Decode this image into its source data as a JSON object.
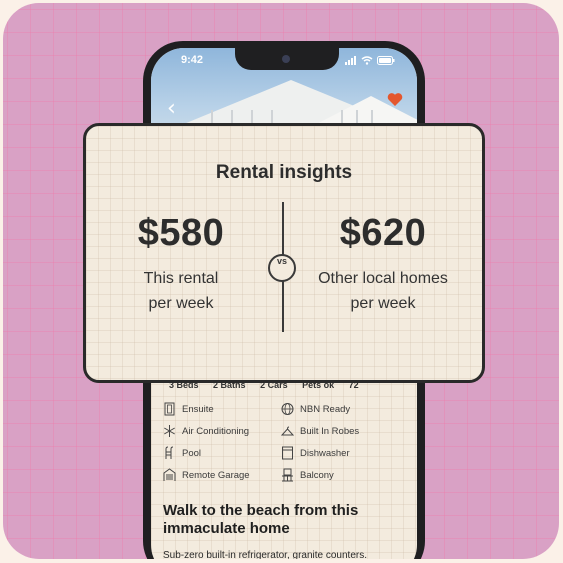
{
  "status_bar": {
    "time": "9:42"
  },
  "listing": {
    "meta": [
      "3 Beds",
      "2 Baths",
      "2 Cars",
      "Pets ok",
      "72"
    ],
    "amenities": [
      {
        "label": "Ensuite",
        "icon": "door-icon"
      },
      {
        "label": "NBN Ready",
        "icon": "globe-icon"
      },
      {
        "label": "Air Conditioning",
        "icon": "snowflake-icon"
      },
      {
        "label": "Built In Robes",
        "icon": "hanger-icon"
      },
      {
        "label": "Pool",
        "icon": "pool-ladder-icon"
      },
      {
        "label": "Dishwasher",
        "icon": "dishwasher-icon"
      },
      {
        "label": "Remote Garage",
        "icon": "garage-icon"
      },
      {
        "label": "Balcony",
        "icon": "balcony-icon"
      }
    ],
    "headline": "Walk to the beach from this immaculate home",
    "description": "Sub-zero built-in refrigerator, granite counters."
  },
  "insights": {
    "title": "Rental insights",
    "vs_label": "vs",
    "left": {
      "price": "$580",
      "line1": "This rental",
      "line2": "per week"
    },
    "right": {
      "price": "$620",
      "line1": "Other local homes",
      "line2": "per week"
    }
  },
  "colors": {
    "background_tile": "#d9a1c5",
    "card": "#f3ebde",
    "favorite_heart": "#e4572e",
    "border": "#2a2a2a"
  }
}
